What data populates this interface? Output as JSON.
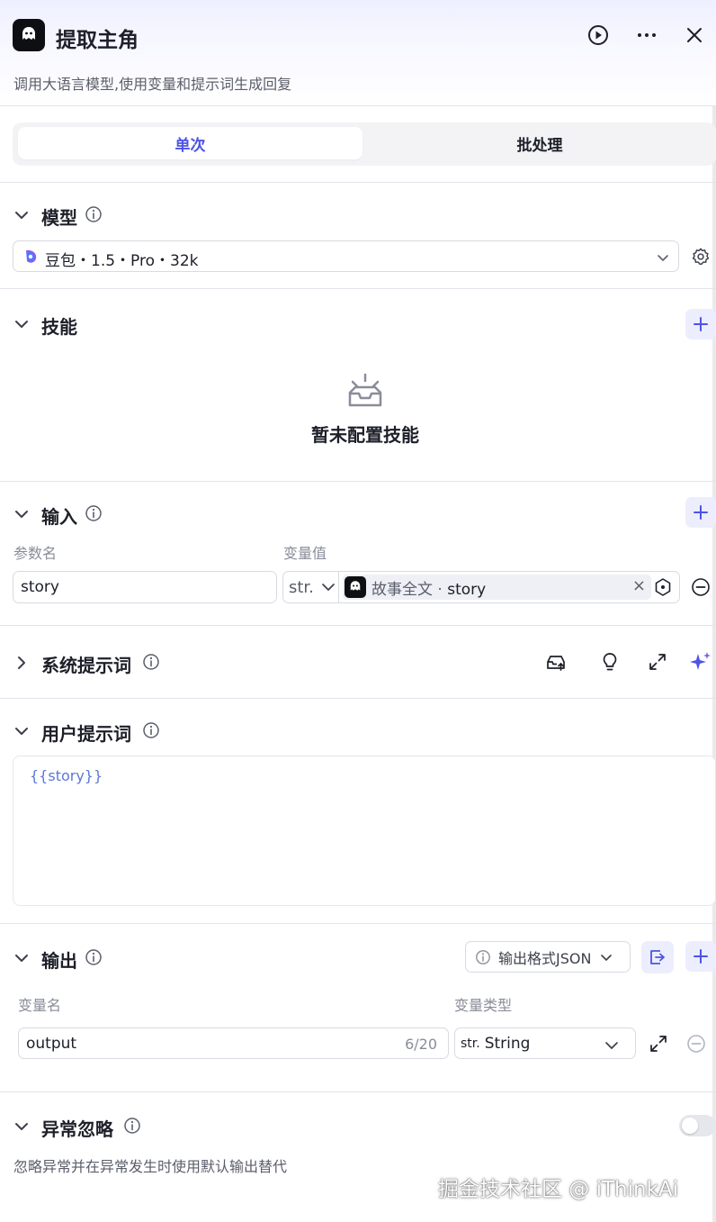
{
  "header": {
    "title": "提取主角",
    "subtitle": "调用大语言模型,使用变量和提示词生成回复",
    "run_icon": "play-circle-icon",
    "more_icon": "more-horizontal-icon",
    "close_icon": "close-icon"
  },
  "tabs": [
    {
      "label": "单次",
      "active": true
    },
    {
      "label": "批处理",
      "active": false
    }
  ],
  "model": {
    "title": "模型",
    "selected": "豆包・1.5・Pro・32k"
  },
  "skills": {
    "title": "技能",
    "empty_text": "暂未配置技能"
  },
  "input": {
    "title": "输入",
    "col_name": "参数名",
    "col_value": "变量值",
    "rows": [
      {
        "name": "story",
        "type": "str.",
        "ref_node": "故事全文",
        "ref_sep": " · ",
        "ref_var": "story",
        "clear": "×"
      }
    ]
  },
  "system_prompt": {
    "title": "系统提示词"
  },
  "user_prompt": {
    "title": "用户提示词",
    "content": "{{story}}"
  },
  "output": {
    "title": "输出",
    "format_label": "输出格式JSON",
    "col_name": "变量名",
    "col_type": "变量类型",
    "rows": [
      {
        "name": "output",
        "counter": "6/20",
        "type_prefix": "str.",
        "type": "String"
      }
    ]
  },
  "exception": {
    "title": "异常忽略",
    "enabled": false,
    "description": "忽略异常并在异常发生时使用默认输出替代"
  },
  "watermark": "掘金技术社区 @ iThinkAi",
  "colors": {
    "accent": "#4d53e8",
    "accent_bg": "#eceefe",
    "border": "#d9dae2",
    "text": "#1d1f29",
    "muted": "#8a8d99"
  }
}
